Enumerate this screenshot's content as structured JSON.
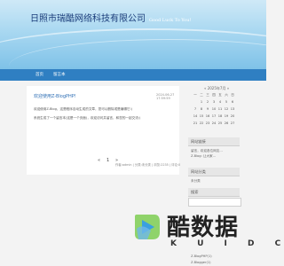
{
  "site": {
    "title": "日照市瑞酷网络科技有限公司",
    "slogan": "Good Luck To You!"
  },
  "nav": {
    "items": [
      "首页",
      "留言本"
    ]
  },
  "post": {
    "title": "欢迎使用Z-BlogPHP!",
    "date": "2024-06-27 17:59:59",
    "lines": [
      "欢迎使用Z-Blog，这是程序自动生成的文章，您可以删除或是编辑它:)",
      "系统生成了一个留言本(这是一个页面)，欢迎访问并留言，和您的一起交流:)"
    ],
    "meta": "作者:admin | 分类:未分类 | 浏览:2235 | 评论:0"
  },
  "pager": {
    "prev": "«",
    "current": "1",
    "next": "»"
  },
  "calendar": {
    "title": "« 2025年7月 »",
    "days": [
      "一",
      "二",
      "三",
      "四",
      "五",
      "六",
      "日"
    ],
    "dates": [
      "1",
      "2",
      "3",
      "4",
      "5",
      "6",
      "7",
      "8",
      "9",
      "10",
      "11",
      "12",
      "13",
      "14",
      "15",
      "16",
      "17",
      "18",
      "19",
      "20",
      "21",
      "22",
      "23",
      "24",
      "25",
      "26",
      "27"
    ]
  },
  "sidebar": {
    "widget1_title": "网站链接",
    "widget1_lines": [
      "留言，欢迎各位网友...",
      "Z-Blog: 让大家..."
    ],
    "widget2_title": "网站分类",
    "widget2_lines": [
      "未分类"
    ],
    "widget3_title": "搜索",
    "tags": [
      "Z-BlogPHP(1)",
      "Z-Blogger(1)"
    ]
  },
  "logo": {
    "text": "酷数据",
    "sub": "K U I D C"
  }
}
